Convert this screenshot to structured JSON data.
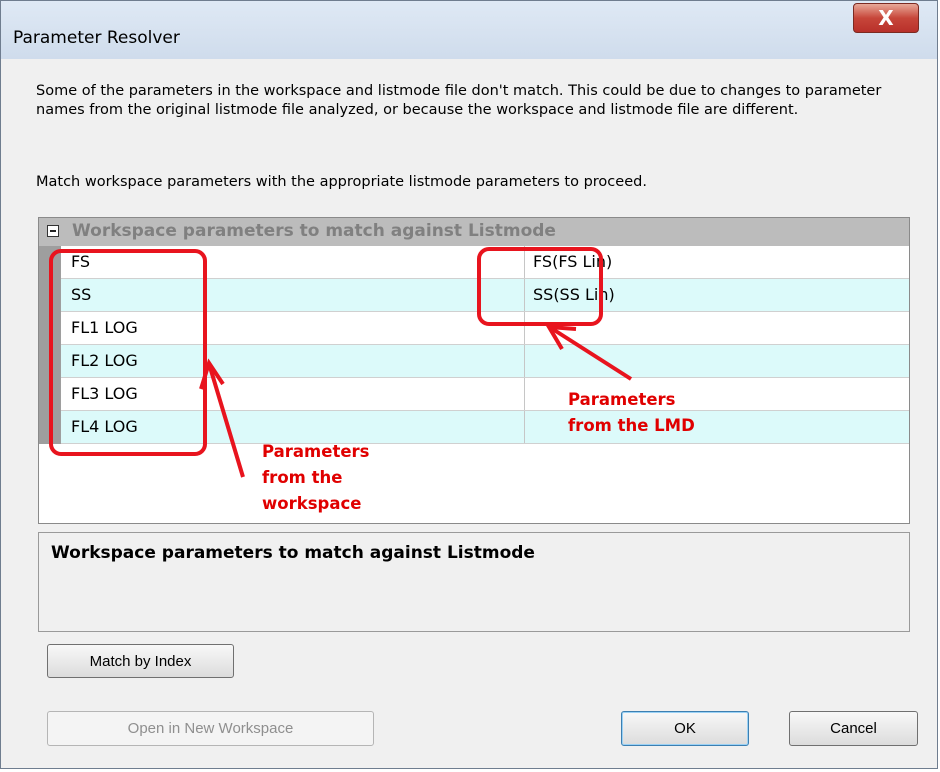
{
  "window": {
    "title": "Parameter Resolver",
    "close_label": "X"
  },
  "description": "Some of the parameters in the workspace and listmode file don't match. This could be due to changes to parameter names from the original listmode file analyzed, or because the workspace and listmode file are different.",
  "instruction": "Match workspace parameters with the appropriate listmode parameters to proceed.",
  "grid": {
    "group_header": "Workspace parameters to match against Listmode",
    "rows": [
      {
        "workspace": "FS",
        "listmode": "FS(FS Lin)"
      },
      {
        "workspace": "SS",
        "listmode": "SS(SS Lin)"
      },
      {
        "workspace": "FL1 LOG",
        "listmode": ""
      },
      {
        "workspace": "FL2 LOG",
        "listmode": ""
      },
      {
        "workspace": "FL3 LOG",
        "listmode": ""
      },
      {
        "workspace": "FL4 LOG",
        "listmode": ""
      }
    ]
  },
  "description_panel": {
    "title": "Workspace parameters to match against Listmode"
  },
  "buttons": {
    "match_by_index": "Match by Index",
    "open_new_workspace": "Open in New Workspace",
    "ok": "OK",
    "cancel": "Cancel"
  },
  "annotations": {
    "workspace_note_1": "Parameters",
    "workspace_note_2": "from the",
    "workspace_note_3": "workspace",
    "lmd_note_1": "Parameters",
    "lmd_note_2": "from the LMD",
    "color": "#e00000"
  }
}
